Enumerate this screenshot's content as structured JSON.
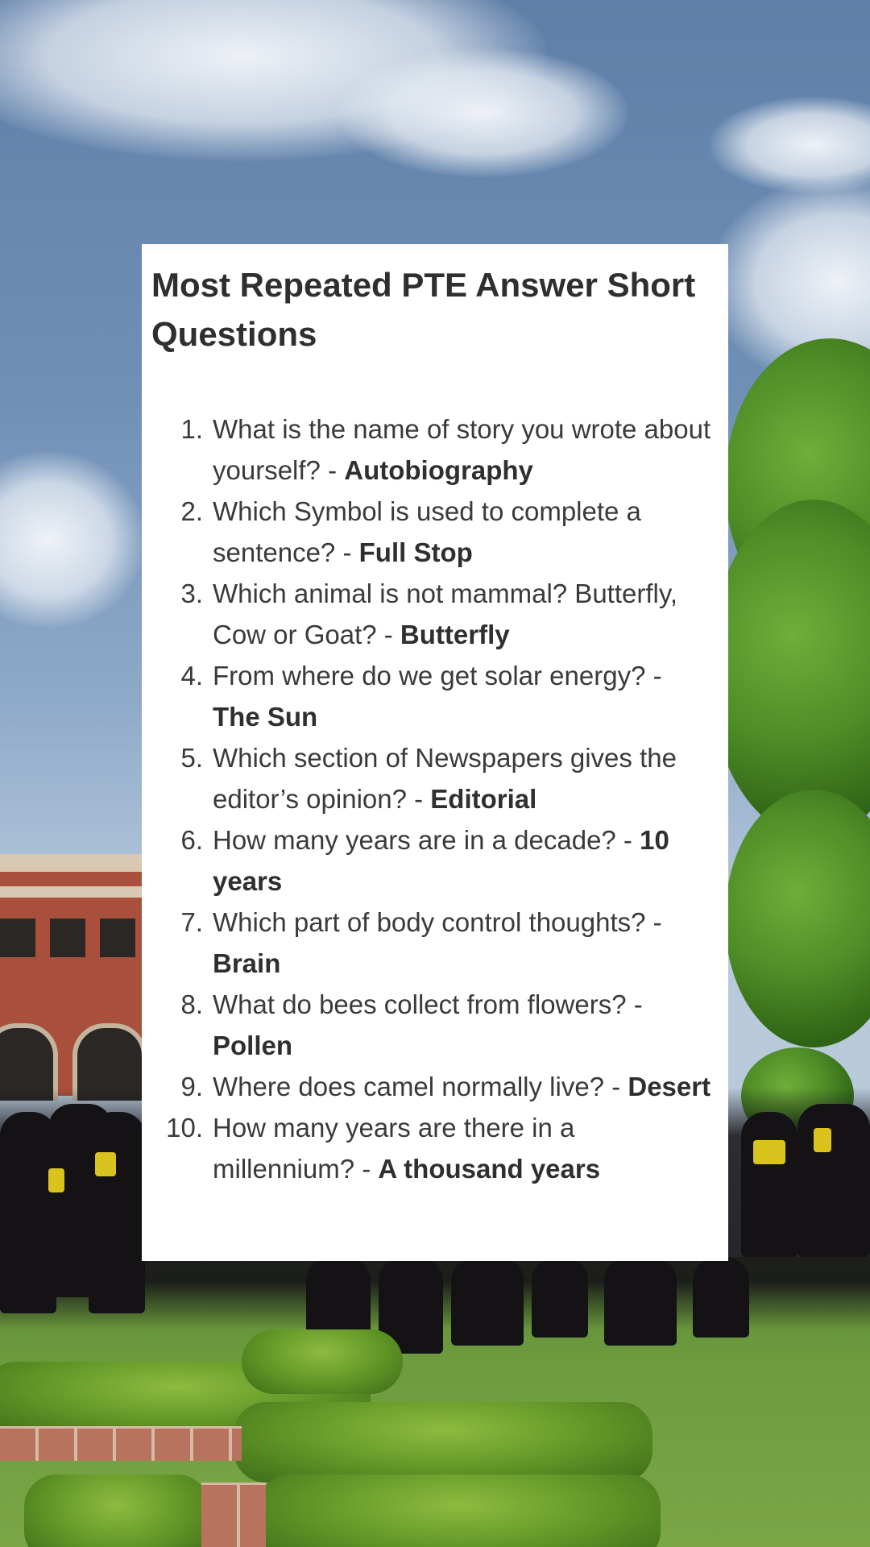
{
  "card": {
    "title": "Most Repeated PTE Answer Short Questions",
    "questions": [
      {
        "number": "1.",
        "question": "What is the name of story you wrote about yourself? - ",
        "answer": "Autobiography"
      },
      {
        "number": "2.",
        "question": "Which Symbol is used to complete a sentence? - ",
        "answer": "Full Stop"
      },
      {
        "number": "3.",
        "question": "Which animal is not mammal? Butterfly, Cow or Goat? - ",
        "answer": "Butterfly"
      },
      {
        "number": "4.",
        "question": "From where do we get solar energy? - ",
        "answer": "The Sun"
      },
      {
        "number": "5.",
        "question": "Which section of Newspapers gives the editor’s opinion? - ",
        "answer": "Editorial"
      },
      {
        "number": "6.",
        "question": "How many years are in a decade? - ",
        "answer": "10 years"
      },
      {
        "number": "7.",
        "question": "Which part of body control thoughts? - ",
        "answer": "Brain"
      },
      {
        "number": "8.",
        "question": "What do bees collect from flowers? - ",
        "answer": "Pollen"
      },
      {
        "number": "9.",
        "question": "Where does camel normally live? - ",
        "answer": "Desert"
      },
      {
        "number": "10.",
        "question": "How many years are there in a millennium? - ",
        "answer": "A thousand years"
      }
    ]
  },
  "colors": {
    "card_background": "#ffffff",
    "title_text": "#2f2f2f",
    "body_text": "#3a3a3a"
  }
}
